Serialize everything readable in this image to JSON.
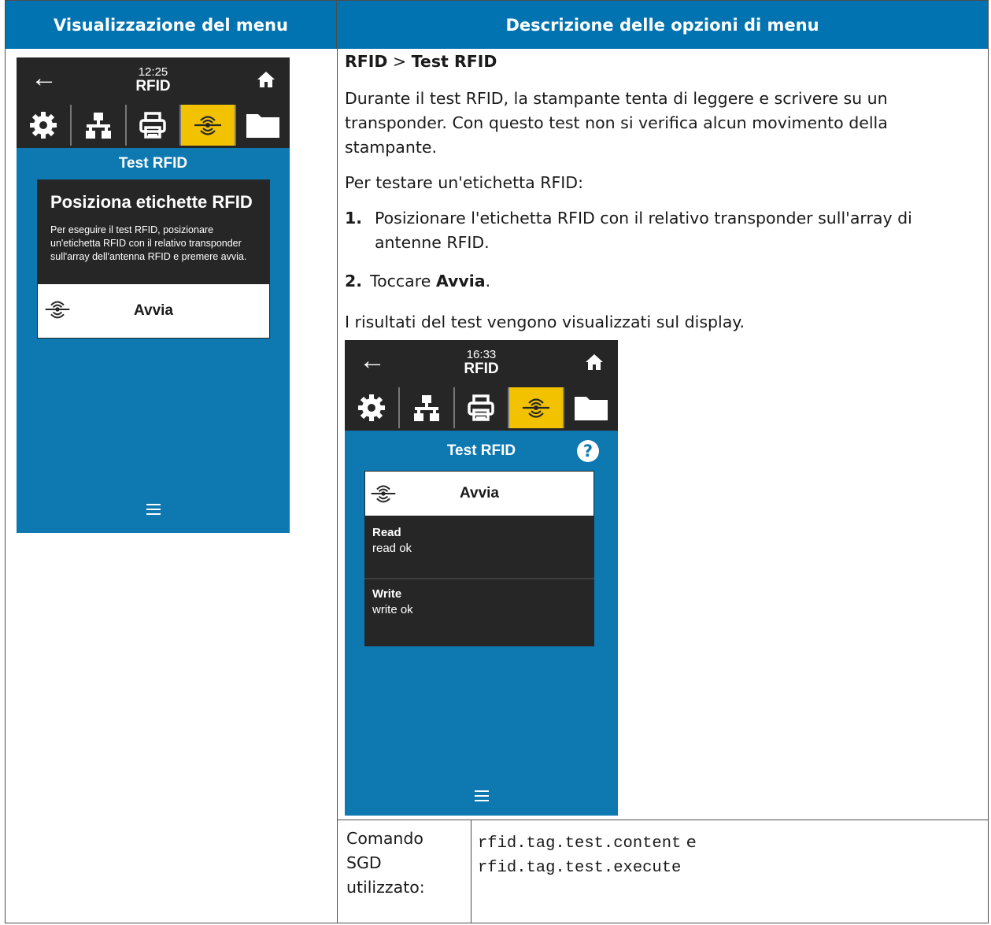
{
  "table": {
    "header_left": "Visualizzazione del menu",
    "header_right": "Descrizione delle opzioni di menu"
  },
  "colors": {
    "header_bg": "#0073b0",
    "screen_bg": "#0e78b0",
    "screen_dark": "#262626",
    "tab_active": "#f2c200"
  },
  "screen1": {
    "time": "12:25",
    "title": "RFID",
    "tabs": [
      "gear-icon",
      "network-icon",
      "printer-icon",
      "rfid-icon",
      "folder-icon"
    ],
    "heading": "Test RFID",
    "dialog_title": "Posiziona etichette RFID",
    "dialog_body": "Per eseguire il test RFID, posizionare un'etichetta RFID con il relativo transponder sull'array dell'antenna RFID e premere avvia.",
    "start_label": "Avvia"
  },
  "description": {
    "crumb_a": "RFID",
    "crumb_sep": " > ",
    "crumb_b": "Test RFID",
    "para1": "Durante il test RFID, la stampante tenta di leggere e scrivere su un transponder. Con questo test non si verifica alcun movimento della stampante.",
    "para2": "Per testare un'etichetta RFID:",
    "step1_num": "1.",
    "step1": "Posizionare l'etichetta RFID con il relativo transponder sull'array di antenne RFID.",
    "step2_num": "2.",
    "step2_pre": "Toccare ",
    "step2_bold": "Avvia",
    "step2_post": ".",
    "para3": "I risultati del test vengono visualizzati sul display."
  },
  "screen2": {
    "time": "16:33",
    "title": "RFID",
    "heading": "Test RFID",
    "help": "?",
    "start_label": "Avvia",
    "read_label": "Read",
    "read_value": "read ok",
    "write_label": "Write",
    "write_value": "write ok"
  },
  "command": {
    "label": "Comando SGD utilizzato:",
    "cmd1": "rfid.tag.test.content",
    "joiner": " e",
    "cmd2": "rfid.tag.test.execute"
  }
}
